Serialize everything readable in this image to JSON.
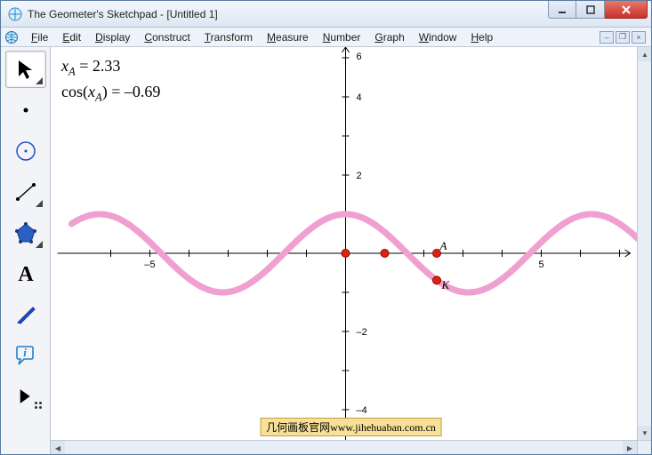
{
  "window": {
    "title": "The Geometer's Sketchpad - [Untitled 1]"
  },
  "menu": {
    "file": "File",
    "edit": "Edit",
    "display": "Display",
    "construct": "Construct",
    "transform": "Transform",
    "measure": "Measure",
    "number": "Number",
    "graph": "Graph",
    "window": "Window",
    "help": "Help"
  },
  "readout": {
    "xA_label_x": "x",
    "xA_label_sub": "A",
    "xA_eq": " = ",
    "xA_val": "2.33",
    "cos_label": "cos",
    "cos_arg_open": "(",
    "cos_arg_x": "x",
    "cos_arg_sub": "A",
    "cos_arg_close": ")",
    "cos_eq": " = ",
    "cos_val": "–0.69"
  },
  "axis": {
    "x_ticks": [
      "–5",
      "5"
    ],
    "y_ticks": [
      "–4",
      "–2",
      "2",
      "4",
      "6"
    ]
  },
  "labels": {
    "pointA": "A",
    "pointK": "K"
  },
  "watermark": "几何画板官网www.jihehuaban.com.cn",
  "chart_data": {
    "type": "line",
    "function": "y = cos(x)",
    "x_range": [
      -7,
      7.5
    ],
    "y_range": [
      -5,
      6.5
    ],
    "series": [
      {
        "name": "cos(x)",
        "color": "#c02070"
      }
    ],
    "points": [
      {
        "name": "origin_marker",
        "x": 0,
        "y": 0,
        "color": "#e02010"
      },
      {
        "name": "unit_marker",
        "x": 1,
        "y": 0,
        "color": "#e02010"
      },
      {
        "name": "A",
        "x": 2.33,
        "y": 0,
        "color": "#e02010",
        "label": "A"
      },
      {
        "name": "K",
        "x": 2.33,
        "y": -0.69,
        "color": "#e02010",
        "label": "K"
      }
    ],
    "xlabel": "",
    "ylabel": "",
    "title": ""
  }
}
